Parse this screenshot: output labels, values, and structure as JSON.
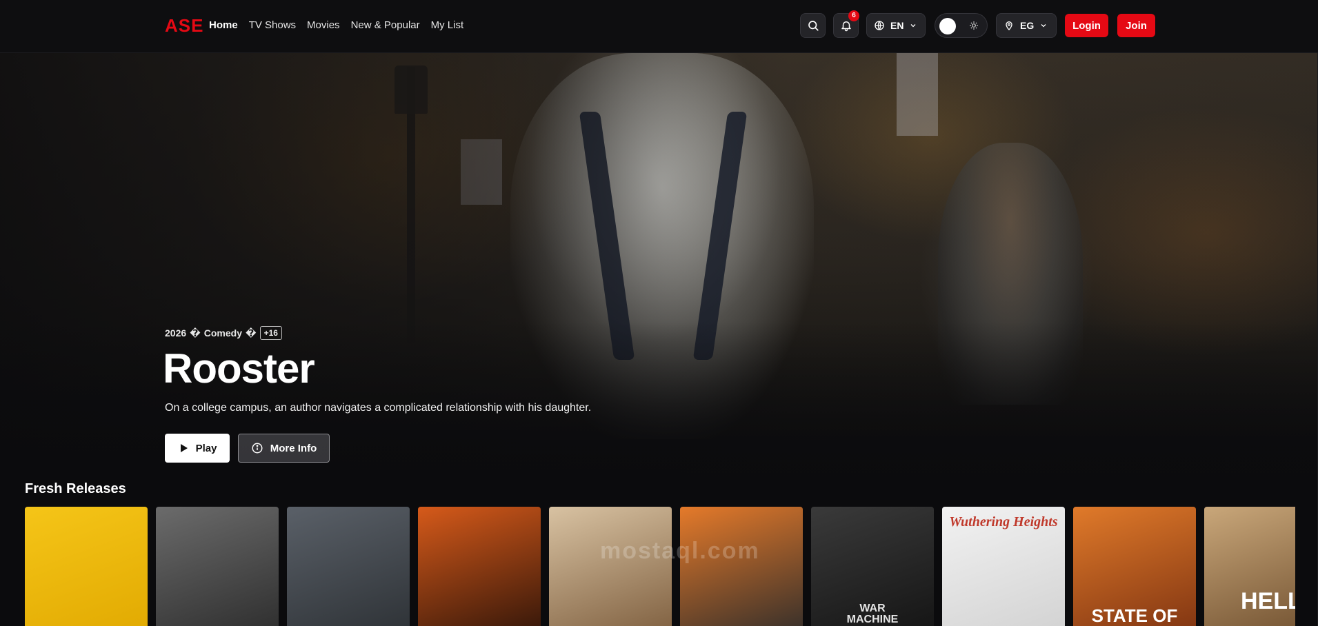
{
  "brand": {
    "name": "ASE",
    "color": "#e50914"
  },
  "nav": {
    "links": [
      {
        "label": "Home",
        "active": true
      },
      {
        "label": "TV Shows",
        "active": false
      },
      {
        "label": "Movies",
        "active": false
      },
      {
        "label": "New & Popular",
        "active": false
      },
      {
        "label": "My List",
        "active": false
      }
    ]
  },
  "header": {
    "search_icon": "search-icon",
    "notifications": {
      "icon": "bell-icon",
      "count": "6"
    },
    "language": {
      "icon": "globe-icon",
      "value": "EN"
    },
    "theme_toggle": {
      "icon": "sun-icon"
    },
    "region": {
      "icon": "map-pin-icon",
      "value": "EG"
    },
    "login_label": "Login",
    "join_label": "Join"
  },
  "hero": {
    "year": "2026",
    "separator": "�",
    "genre": "Comedy",
    "rating": "+16",
    "title": "Rooster",
    "description": "On a college campus, an author navigates a complicated relationship with his daughter.",
    "play_label": "Play",
    "more_info_label": "More Info"
  },
  "fresh_releases": {
    "title": "Fresh Releases",
    "posters": [
      {
        "caption": "",
        "colors": [
          "#f5c518",
          "#e0a800"
        ]
      },
      {
        "caption": "",
        "colors": [
          "#6b6b6b",
          "#2a2a2a"
        ]
      },
      {
        "caption": "",
        "colors": [
          "#5a6068",
          "#2b2f33"
        ]
      },
      {
        "caption": "",
        "colors": [
          "#d65a1a",
          "#2a1208"
        ]
      },
      {
        "caption": "",
        "colors": [
          "#d8c2a2",
          "#7a5a3a"
        ]
      },
      {
        "caption": "",
        "colors": [
          "#e57a2a",
          "#2a2a2a"
        ]
      },
      {
        "caption": "WAR\nMACHINE",
        "colors": [
          "#3a3a3a",
          "#121212"
        ]
      },
      {
        "caption": "Wuthering Heights",
        "colors": [
          "#f2f2f2",
          "#d0d0d0"
        ]
      },
      {
        "caption": "STATE OF",
        "colors": [
          "#e07a2a",
          "#7a3010"
        ]
      },
      {
        "caption": "HELLFI",
        "colors": [
          "#c9a77a",
          "#6a4a2a"
        ]
      }
    ]
  },
  "watermark": "mostaql.com"
}
